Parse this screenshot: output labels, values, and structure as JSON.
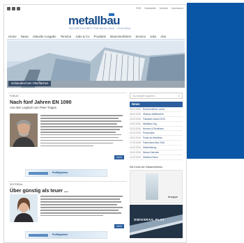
{
  "topbar": {
    "links": [
      "RSS",
      "Newsletter",
      "Kontakt",
      "Impressum"
    ]
  },
  "logo": {
    "wordmark": "metallbau",
    "tagline": "FACHZEITSCHRIFT FÜR METALLBAU · STAHLBAU"
  },
  "nav": {
    "items": [
      "Home",
      "News",
      "Aktuelle Ausgabe",
      "Termine",
      "Jobs & Co",
      "Produkte",
      "Branchenführer",
      "Service",
      "Jobs",
      "Abo"
    ]
  },
  "hero": {
    "caption": "Gebäudeschutz Oberflächen"
  },
  "articles": [
    {
      "section": "FOKUS",
      "title": "Nach fünf Jahren EN 1090",
      "subtitle": "Aus dem Logbuch von Peter Trappe",
      "more_label": "mehr"
    },
    {
      "section": "EDITORIAL",
      "title": "Über günstig als teuer ...",
      "more_label": "mehr"
    }
  ],
  "banners": [
    {
      "label": "Profilsysteme"
    },
    {
      "label": "Profilsysteme"
    }
  ],
  "sidebar": {
    "search_placeholder": "Suchbegriff eingeben ...",
    "news_heading": "News",
    "news": [
      {
        "date": "29.03.2016",
        "title": "Branchenführer online"
      },
      {
        "date": "28.03.2016",
        "title": "Glasbau Wettbewerb"
      },
      {
        "date": "24.03.2016",
        "title": "Fassaden Award 2016"
      },
      {
        "date": "23.03.2016",
        "title": "Metallbau Tag"
      },
      {
        "date": "22.03.2016",
        "title": "Normen & Richtlinien"
      },
      {
        "date": "21.03.2016",
        "title": "Personalien"
      },
      {
        "date": "18.03.2016",
        "title": "Praxis im Metallbau"
      },
      {
        "date": "17.03.2016",
        "title": "Fachmesse Bau 2016"
      },
      {
        "date": "16.03.2016",
        "title": "Weiterbildung"
      },
      {
        "date": "15.03.2016",
        "title": "Messe-Kalender"
      },
      {
        "date": "14.03.2016",
        "title": "Stahlbau News"
      }
    ],
    "ad_title": "Die Kunst der Glasarchitektur",
    "ad_brand": "hueppe",
    "rail_label": "SWISSRAIL FLAT"
  }
}
